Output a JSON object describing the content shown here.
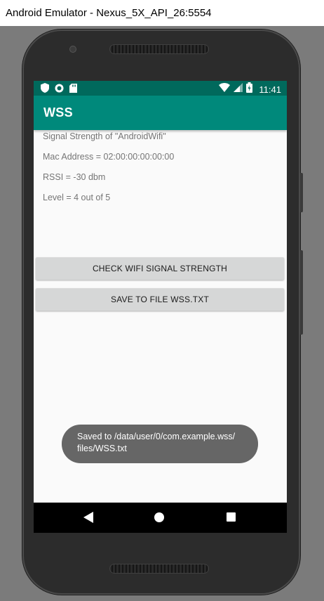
{
  "window": {
    "title": "Android Emulator - Nexus_5X_API_26:5554"
  },
  "status_bar": {
    "time": "11:41",
    "left_icons": [
      "shield-icon",
      "sync-icon",
      "sd-card-icon"
    ],
    "right_icons": [
      "wifi-icon",
      "cell-signal-icon",
      "battery-icon"
    ]
  },
  "app": {
    "title": "WSS",
    "colors": {
      "primary": "#00897b",
      "primary_dark": "#00695c"
    },
    "info": {
      "signal_strength": "Signal Strength of \"AndroidWifi\"",
      "mac_address": "Mac Address = 02:00:00:00:00:00",
      "rssi": "RSSI = -30 dbm",
      "level": "Level = 4 out of 5"
    },
    "buttons": {
      "check": "CHECK WIFI SIGNAL STRENGTH",
      "save": "SAVE TO FILE WSS.TXT"
    },
    "toast": "Saved to /data/user/0/com.example.wss/\nfiles/WSS.txt"
  },
  "nav_bar": {
    "icons": [
      "back-icon",
      "home-icon",
      "recents-icon"
    ]
  }
}
